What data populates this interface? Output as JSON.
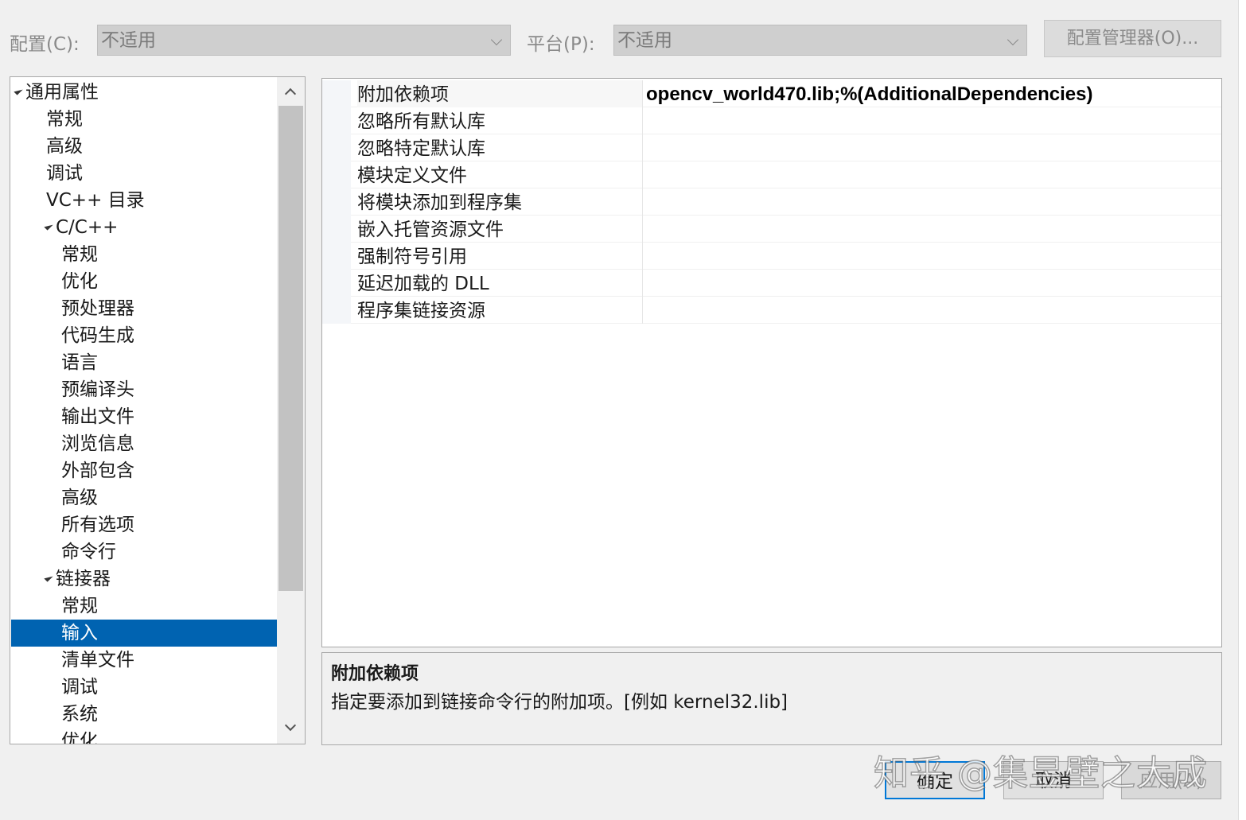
{
  "config_bar": {
    "config_label": "配置(C):",
    "config_value": "不适用",
    "platform_label": "平台(P):",
    "platform_value": "不适用",
    "config_manager_label": "配置管理器(O)..."
  },
  "tree": {
    "items": [
      {
        "label": "通用属性",
        "level": 0,
        "expanded": true,
        "selected": false
      },
      {
        "label": "常规",
        "level": 1,
        "expanded": null,
        "selected": false
      },
      {
        "label": "高级",
        "level": 1,
        "expanded": null,
        "selected": false
      },
      {
        "label": "调试",
        "level": 1,
        "expanded": null,
        "selected": false
      },
      {
        "label": "VC++ 目录",
        "level": 1,
        "expanded": null,
        "selected": false
      },
      {
        "label": "C/C++",
        "level": 1,
        "expanded": true,
        "selected": false
      },
      {
        "label": "常规",
        "level": 2,
        "expanded": null,
        "selected": false
      },
      {
        "label": "优化",
        "level": 2,
        "expanded": null,
        "selected": false
      },
      {
        "label": "预处理器",
        "level": 2,
        "expanded": null,
        "selected": false
      },
      {
        "label": "代码生成",
        "level": 2,
        "expanded": null,
        "selected": false
      },
      {
        "label": "语言",
        "level": 2,
        "expanded": null,
        "selected": false
      },
      {
        "label": "预编译头",
        "level": 2,
        "expanded": null,
        "selected": false
      },
      {
        "label": "输出文件",
        "level": 2,
        "expanded": null,
        "selected": false
      },
      {
        "label": "浏览信息",
        "level": 2,
        "expanded": null,
        "selected": false
      },
      {
        "label": "外部包含",
        "level": 2,
        "expanded": null,
        "selected": false
      },
      {
        "label": "高级",
        "level": 2,
        "expanded": null,
        "selected": false
      },
      {
        "label": "所有选项",
        "level": 2,
        "expanded": null,
        "selected": false
      },
      {
        "label": "命令行",
        "level": 2,
        "expanded": null,
        "selected": false
      },
      {
        "label": "链接器",
        "level": 1,
        "expanded": true,
        "selected": false
      },
      {
        "label": "常规",
        "level": 2,
        "expanded": null,
        "selected": false
      },
      {
        "label": "输入",
        "level": 2,
        "expanded": null,
        "selected": true
      },
      {
        "label": "清单文件",
        "level": 2,
        "expanded": null,
        "selected": false
      },
      {
        "label": "调试",
        "level": 2,
        "expanded": null,
        "selected": false
      },
      {
        "label": "系统",
        "level": 2,
        "expanded": null,
        "selected": false
      },
      {
        "label": "优化",
        "level": 2,
        "expanded": null,
        "selected": false
      }
    ]
  },
  "properties": [
    {
      "name": "附加依赖项",
      "value": "opencv_world470.lib;%(AdditionalDependencies)"
    },
    {
      "name": "忽略所有默认库",
      "value": ""
    },
    {
      "name": "忽略特定默认库",
      "value": ""
    },
    {
      "name": "模块定义文件",
      "value": ""
    },
    {
      "name": "将模块添加到程序集",
      "value": ""
    },
    {
      "name": "嵌入托管资源文件",
      "value": ""
    },
    {
      "name": "强制符号引用",
      "value": ""
    },
    {
      "name": "延迟加载的 DLL",
      "value": ""
    },
    {
      "name": "程序集链接资源",
      "value": ""
    }
  ],
  "description": {
    "title": "附加依赖项",
    "text": "指定要添加到链接命令行的附加项。[例如 kernel32.lib]"
  },
  "buttons": {
    "ok": "确定",
    "cancel": "取消",
    "apply": "应用(A)"
  },
  "watermark": "知乎 @集昱壁之大成",
  "colors": {
    "selection": "#0063b1",
    "ok_border": "#0078d7"
  }
}
